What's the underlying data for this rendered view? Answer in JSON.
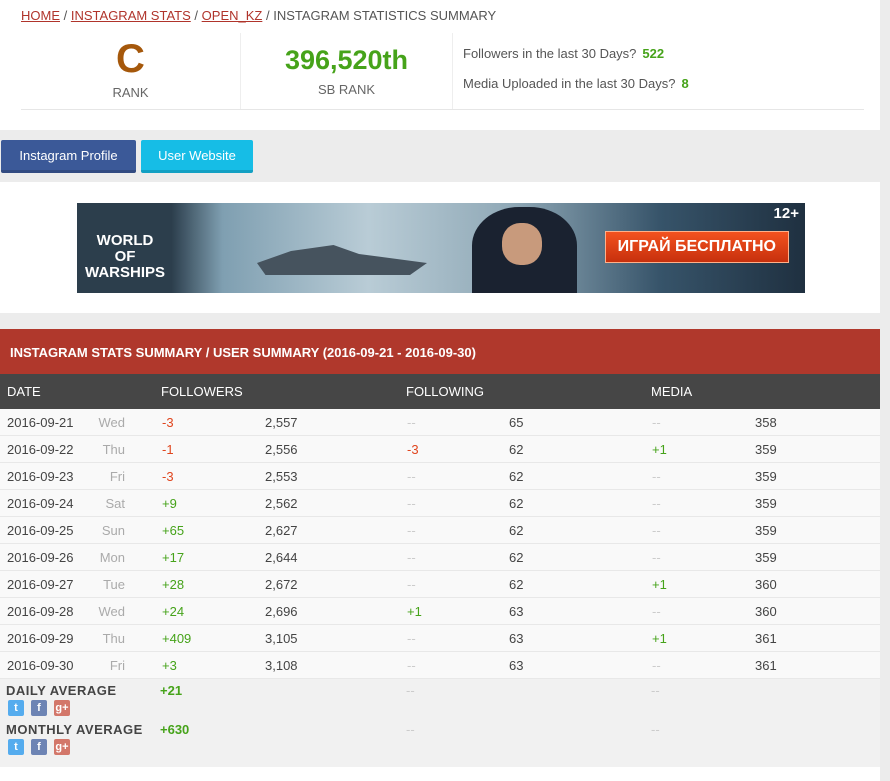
{
  "breadcrumb": {
    "home": "HOME",
    "stats": "INSTAGRAM STATS",
    "user": "OPEN_KZ",
    "current": "INSTAGRAM STATISTICS SUMMARY",
    "sep": "/"
  },
  "summary": {
    "grade": "C",
    "grade_label": "RANK",
    "sb_rank": "396,520th",
    "sb_rank_label": "SB RANK",
    "followers_label": "Followers in the last 30 Days?",
    "followers_value": "522",
    "media_label": "Media Uploaded in the last 30 Days?",
    "media_value": "8"
  },
  "buttons": {
    "profile": "Instagram Profile",
    "website": "User Website"
  },
  "ad": {
    "logo": "WORLD OF WARSHIPS",
    "cta": "ИГРАЙ БЕСПЛАТНО",
    "age": "12+"
  },
  "colors": {
    "grade": "#a5580b",
    "rank": "#46a31a",
    "header": "#b0382c",
    "positive": "#46a31a",
    "negative": "#e0461e"
  },
  "table": {
    "title": "INSTAGRAM STATS SUMMARY / USER SUMMARY (2016-09-21 - 2016-09-30)",
    "columns": [
      "DATE",
      "FOLLOWERS",
      "FOLLOWING",
      "MEDIA"
    ],
    "rows": [
      {
        "date": "2016-09-21",
        "day": "Wed",
        "fc": "-3",
        "ft": "2,557",
        "gc": "--",
        "gt": "65",
        "mc": "--",
        "mt": "358"
      },
      {
        "date": "2016-09-22",
        "day": "Thu",
        "fc": "-1",
        "ft": "2,556",
        "gc": "-3",
        "gt": "62",
        "mc": "+1",
        "mt": "359"
      },
      {
        "date": "2016-09-23",
        "day": "Fri",
        "fc": "-3",
        "ft": "2,553",
        "gc": "--",
        "gt": "62",
        "mc": "--",
        "mt": "359"
      },
      {
        "date": "2016-09-24",
        "day": "Sat",
        "fc": "+9",
        "ft": "2,562",
        "gc": "--",
        "gt": "62",
        "mc": "--",
        "mt": "359"
      },
      {
        "date": "2016-09-25",
        "day": "Sun",
        "fc": "+65",
        "ft": "2,627",
        "gc": "--",
        "gt": "62",
        "mc": "--",
        "mt": "359"
      },
      {
        "date": "2016-09-26",
        "day": "Mon",
        "fc": "+17",
        "ft": "2,644",
        "gc": "--",
        "gt": "62",
        "mc": "--",
        "mt": "359"
      },
      {
        "date": "2016-09-27",
        "day": "Tue",
        "fc": "+28",
        "ft": "2,672",
        "gc": "--",
        "gt": "62",
        "mc": "+1",
        "mt": "360"
      },
      {
        "date": "2016-09-28",
        "day": "Wed",
        "fc": "+24",
        "ft": "2,696",
        "gc": "+1",
        "gt": "63",
        "mc": "--",
        "mt": "360"
      },
      {
        "date": "2016-09-29",
        "day": "Thu",
        "fc": "+409",
        "ft": "3,105",
        "gc": "--",
        "gt": "63",
        "mc": "+1",
        "mt": "361"
      },
      {
        "date": "2016-09-30",
        "day": "Fri",
        "fc": "+3",
        "ft": "3,108",
        "gc": "--",
        "gt": "63",
        "mc": "--",
        "mt": "361"
      }
    ],
    "daily": {
      "label": "DAILY AVERAGE",
      "followers": "+21",
      "following": "--",
      "media": "--"
    },
    "monthly": {
      "label": "MONTHLY AVERAGE",
      "followers": "+630",
      "following": "--",
      "media": "--"
    }
  }
}
